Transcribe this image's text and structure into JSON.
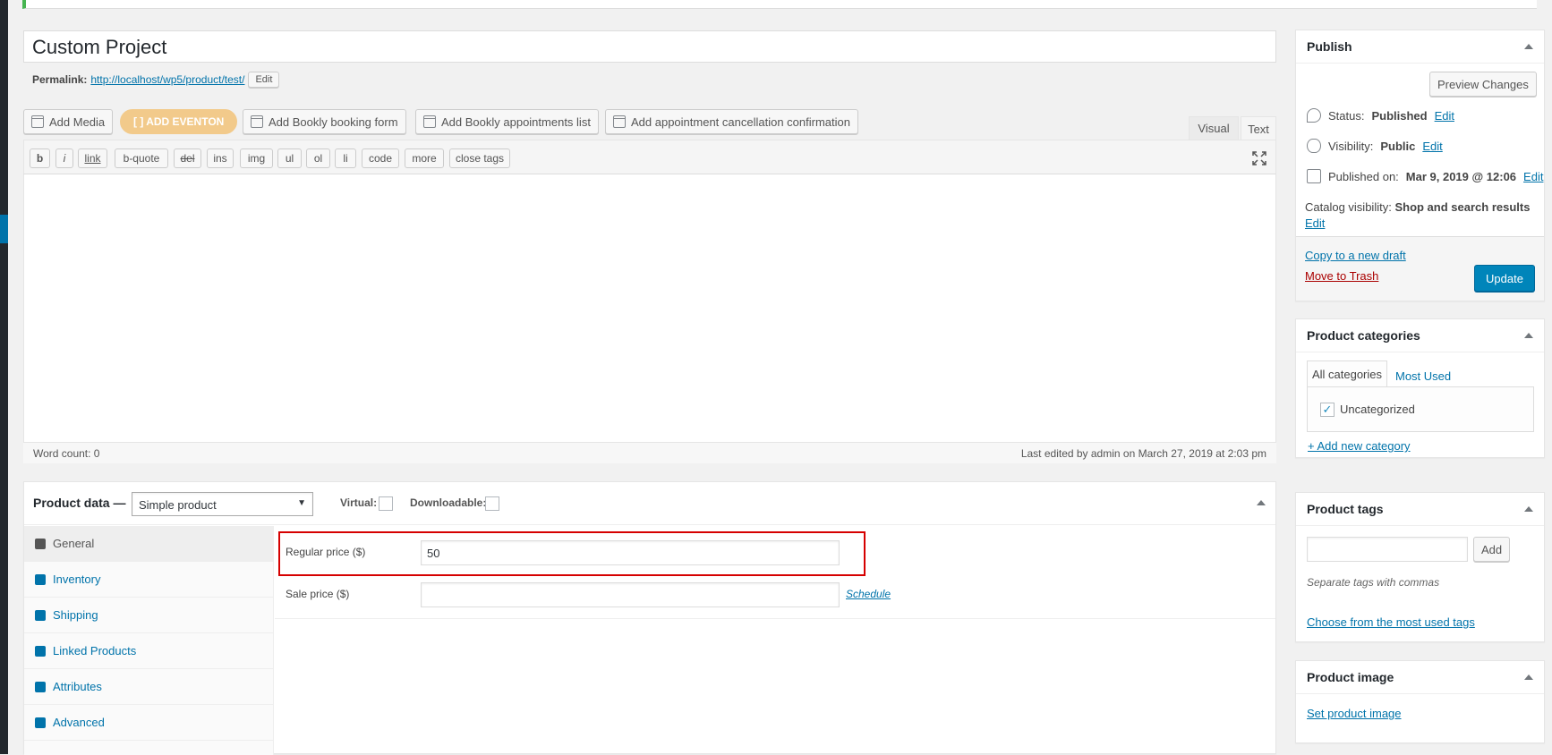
{
  "title": "Custom Project",
  "permalink": {
    "label": "Permalink:",
    "url": "http://localhost/wp5/product/test/",
    "edit": "Edit"
  },
  "media_buttons": {
    "add_media": "Add Media",
    "eventon": "[ ] ADD EVENTON",
    "bookly_form": "Add Bookly booking form",
    "bookly_list": "Add Bookly appointments list",
    "cancel_confirm": "Add appointment cancellation confirmation"
  },
  "editor_tabs": {
    "visual": "Visual",
    "text": "Text"
  },
  "quicktags": [
    "b",
    "i",
    "link",
    "b-quote",
    "del",
    "ins",
    "img",
    "ul",
    "ol",
    "li",
    "code",
    "more",
    "close tags"
  ],
  "status_bar": {
    "word_count": "Word count: 0",
    "last_edited": "Last edited by admin on March 27, 2019 at 2:03 pm"
  },
  "product_data": {
    "label": "Product data —",
    "type": "Simple product",
    "virtual": "Virtual:",
    "downloadable": "Downloadable:",
    "tabs": [
      "General",
      "Inventory",
      "Shipping",
      "Linked Products",
      "Attributes",
      "Advanced"
    ],
    "regular_price_label": "Regular price ($)",
    "regular_price": "50",
    "sale_price_label": "Sale price ($)",
    "sale_price": "",
    "schedule": "Schedule"
  },
  "publish": {
    "title": "Publish",
    "preview": "Preview Changes",
    "status_label": "Status:",
    "status": "Published",
    "visibility_label": "Visibility:",
    "visibility": "Public",
    "published_label": "Published on:",
    "published": "Mar 9, 2019 @ 12:06",
    "catalog_label": "Catalog visibility:",
    "catalog": "Shop and search results",
    "edit": "Edit",
    "copy_draft": "Copy to a new draft",
    "trash": "Move to Trash",
    "update": "Update"
  },
  "categories": {
    "title": "Product categories",
    "tab_all": "All categories",
    "tab_used": "Most Used",
    "items": [
      "Uncategorized"
    ],
    "add_new": "+ Add new category"
  },
  "tags": {
    "title": "Product tags",
    "add": "Add",
    "help": "Separate tags with commas",
    "choose": "Choose from the most used tags"
  },
  "image": {
    "title": "Product image",
    "set": "Set product image"
  },
  "colors": {
    "accent": "#0073aa",
    "highlight_border": "#d60000",
    "eventon": "#f2ca8b",
    "trash": "#a00"
  }
}
